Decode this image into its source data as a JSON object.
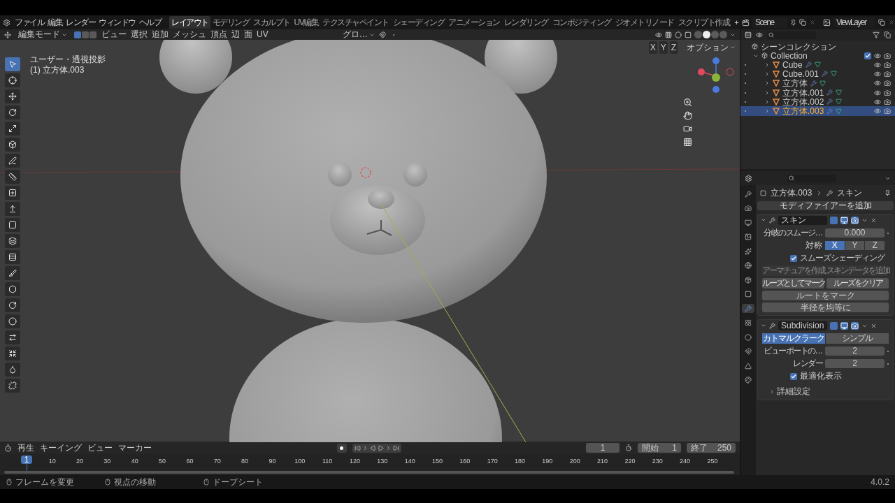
{
  "menu": [
    "ファイル",
    "編集",
    "レンダー",
    "ウィンドウ",
    "ヘルプ"
  ],
  "workspaces": [
    {
      "label": "レイアウト",
      "selected": true
    },
    {
      "label": "モデリング",
      "selected": false
    },
    {
      "label": "スカルプト",
      "selected": false
    },
    {
      "label": "UV編集",
      "selected": false
    },
    {
      "label": "テクスチャペイント",
      "selected": false
    },
    {
      "label": "シェーディング",
      "selected": false
    },
    {
      "label": "アニメーション",
      "selected": false
    },
    {
      "label": "レンダリング",
      "selected": false
    },
    {
      "label": "コンポジティング",
      "selected": false
    },
    {
      "label": "ジオメトリノード",
      "selected": false
    },
    {
      "label": "スクリプト作成",
      "selected": false
    }
  ],
  "add_workspace": "+",
  "scene": "Scene",
  "view_layer": "ViewLayer",
  "viewport": {
    "mode": "編集モード",
    "select_modes": [
      {
        "selected": true
      },
      {
        "selected": false
      },
      {
        "selected": false
      }
    ],
    "menus": [
      "ビュー",
      "選択",
      "追加",
      "メッシュ",
      "頂点",
      "辺",
      "面",
      "UV"
    ],
    "orientation": "グロ…",
    "shading": [
      {
        "selected": false
      },
      {
        "selected": true
      },
      {
        "selected": false
      },
      {
        "selected": false
      }
    ],
    "axes": [
      "X",
      "Y",
      "Z"
    ],
    "options": "オプション",
    "view_info": "ユーザー・透視投影",
    "object_info": "(1) 立方体.003",
    "tools": [
      {
        "selected": true
      },
      {
        "selected": false
      },
      {
        "selected": false
      },
      {
        "selected": false
      },
      {
        "selected": false
      },
      {
        "selected": false
      },
      {
        "selected": false
      },
      {
        "selected": false
      },
      {
        "selected": false
      },
      {
        "selected": false
      },
      {
        "selected": false
      },
      {
        "selected": false
      },
      {
        "selected": false
      },
      {
        "selected": false
      },
      {
        "selected": false
      },
      {
        "selected": false
      },
      {
        "selected": false
      },
      {
        "selected": false
      },
      {
        "selected": false
      },
      {
        "selected": false
      },
      {
        "selected": false
      }
    ]
  },
  "outliner": {
    "root": "シーンコレクション",
    "collection": {
      "label": "Collection",
      "checked": true,
      "expanded": true,
      "children": [
        {
          "label": "Cube",
          "selected": false
        },
        {
          "label": "Cube.001",
          "selected": false
        },
        {
          "label": "立方体",
          "selected": false
        },
        {
          "label": "立方体.001",
          "selected": false
        },
        {
          "label": "立方体.002",
          "selected": false
        },
        {
          "label": "立方体.003",
          "selected": true
        }
      ]
    }
  },
  "properties": {
    "tabs": [
      {
        "selected": false
      },
      {
        "selected": false
      },
      {
        "selected": false
      },
      {
        "selected": false
      },
      {
        "selected": false
      },
      {
        "selected": false
      },
      {
        "selected": false
      },
      {
        "selected": false
      },
      {
        "selected": true
      },
      {
        "selected": false
      },
      {
        "selected": false
      },
      {
        "selected": false
      },
      {
        "selected": false
      },
      {
        "selected": false
      }
    ],
    "breadcrumb": [
      "立方体.003",
      "スキン"
    ],
    "add_modifier": "モディファイアーを追加",
    "modifiers": [
      {
        "kind": "skin",
        "name": "スキン",
        "expanded": true,
        "smoothing_label": "分岐のスムージ…",
        "smoothing_value": "0.000",
        "symmetry_label": "対称",
        "axes": [
          {
            "label": "X",
            "selected": true
          },
          {
            "label": "Y",
            "selected": false
          },
          {
            "label": "Z",
            "selected": false
          }
        ],
        "smooth_label": "スムーズシェーディング",
        "smooth_checked": true,
        "buttons": [
          {
            "label": "アーマチュアを作成",
            "disabled": true
          },
          {
            "label": "スキンデータを追加",
            "disabled": true
          },
          {
            "label": "ルーズとしてマーク",
            "disabled": false
          },
          {
            "label": "ルーズをクリア",
            "disabled": false
          }
        ],
        "wide_buttons": [
          "ルートをマーク",
          "半径を均等に"
        ]
      },
      {
        "kind": "subdivision",
        "name": "Subdivision",
        "expanded": true,
        "modes": [
          {
            "label": "カトマルクラーク",
            "selected": true
          },
          {
            "label": "シンプル",
            "selected": false
          }
        ],
        "fields": [
          {
            "label": "ビューポートの…",
            "value": "2"
          },
          {
            "label": "レンダー",
            "value": "2"
          }
        ],
        "optimal_label": "最適化表示",
        "optimal_checked": true,
        "advanced_label": "詳細設定",
        "advanced_expanded": false
      }
    ]
  },
  "timeline": {
    "menus": [
      "再生",
      "キーイング",
      "ビュー",
      "マーカー"
    ],
    "current_frame": "1",
    "start_label": "開始",
    "start": "1",
    "end_label": "終了",
    "end": "250",
    "playhead": "1",
    "ticks": [
      "10",
      "20",
      "30",
      "40",
      "50",
      "60",
      "70",
      "80",
      "90",
      "100",
      "110",
      "120",
      "130",
      "140",
      "150",
      "160",
      "170",
      "180",
      "190",
      "200",
      "210",
      "220",
      "230",
      "240",
      "250"
    ]
  },
  "status_bar": {
    "hints": [
      "フレームを変更",
      "視点の移動",
      "ドープシート"
    ],
    "version": "4.0.2"
  }
}
